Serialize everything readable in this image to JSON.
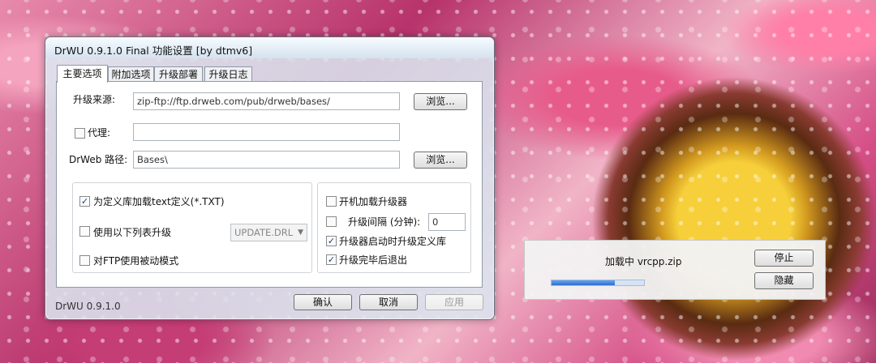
{
  "window": {
    "title": "DrWU 0.9.1.0 Final 功能设置 [by dtmv6]",
    "tabs": [
      {
        "label": "主要选项"
      },
      {
        "label": "附加选项"
      },
      {
        "label": "升级部署"
      },
      {
        "label": "升级日志"
      }
    ],
    "source_label": "升级来源:",
    "source_value": "zip-ftp://ftp.drweb.com/pub/drweb/bases/",
    "browse_label": "浏览...",
    "proxy_label": "代理:",
    "proxy_value": "",
    "drweb_path_label": "DrWeb 路径:",
    "drweb_path_value": "Bases\\",
    "browse2_label": "浏览...",
    "left_group": {
      "option1": "为定义库加载text定义(*.TXT)",
      "option2": "使用以下列表升级",
      "option2_select": "UPDATE.DRL",
      "option3": "对FTP使用被动模式"
    },
    "right_group": {
      "option1": "开机加载升级器",
      "option2": "升级间隔 (分钟):",
      "interval_value": "0",
      "option3": "升级器启动时升级定义库",
      "option4": "升级完毕后退出"
    },
    "footer_version": "DrWU  0.9.1.0",
    "confirm_label": "确认",
    "cancel_label": "取消",
    "apply_label": "应用"
  },
  "toast": {
    "loading_text": "加载中  vrcpp.zip",
    "stop_label": "停止",
    "hide_label": "隐藏",
    "progress_fraction": 0.68
  },
  "checks": {
    "proxy_checked": "",
    "left1_checked": "✓",
    "left2_checked": "",
    "left3_checked": "",
    "right1_checked": "",
    "right2_checked": "",
    "right3_checked": "✓",
    "right4_checked": "✓"
  }
}
